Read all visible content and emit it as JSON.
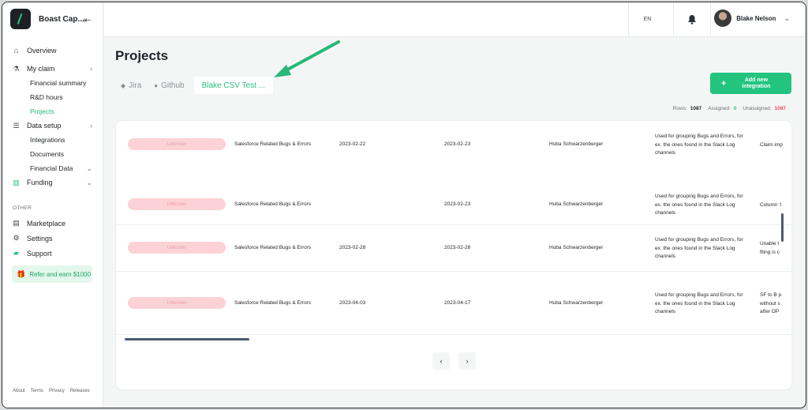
{
  "app": {
    "name": "Boast Cap..."
  },
  "sidebar": {
    "items": [
      {
        "label": "Overview",
        "icon": "home-icon"
      },
      {
        "label": "My claim",
        "icon": "flask-icon"
      },
      {
        "label": "Financial summary"
      },
      {
        "label": "R&D hours"
      },
      {
        "label": "Projects"
      },
      {
        "label": "Data setup",
        "icon": "list-icon"
      },
      {
        "label": "Integrations"
      },
      {
        "label": "Documents"
      },
      {
        "label": "Financial Data"
      },
      {
        "label": "Funding",
        "icon": "bank-icon"
      }
    ],
    "other_label": "OTHER",
    "other_items": [
      {
        "label": "Marketplace",
        "icon": "store-icon"
      },
      {
        "label": "Settings",
        "icon": "gear-icon"
      },
      {
        "label": "Support",
        "icon": "chat-icon"
      }
    ],
    "refer_label": "Refer and earn $1000",
    "footer": [
      "About",
      "Terms",
      "Privacy",
      "Releases"
    ]
  },
  "topbar": {
    "lang": "EN",
    "user_name": "Blake Nelson"
  },
  "page": {
    "title": "Projects",
    "tabs": [
      {
        "label": "Jira",
        "icon": "tag-icon"
      },
      {
        "label": "Github",
        "icon": "github-icon"
      },
      {
        "label": "Blake CSV Test ..."
      }
    ],
    "add_button": "Add new integration",
    "stats": {
      "rows_label": "Rows:",
      "rows": "1087",
      "assigned_label": "Assigned:",
      "assigned": "0",
      "unassigned_label": "Unassigned:",
      "unassigned": "1087"
    }
  },
  "table": {
    "rows": [
      {
        "status": "Unknown",
        "name": "Salesforce Related Bugs & Errors",
        "start": "2023-02-22",
        "end": "2023-02-23",
        "owner": "Huba Schwarzenberger",
        "description": "Used for grouping Bugs and Errors, for ex. the ones found in the Slack Log channels",
        "extra": "Claim imp"
      },
      {
        "status": "Unknown",
        "name": "Salesforce Related Bugs & Errors",
        "start": "",
        "end": "2023-02-23",
        "owner": "Huba Schwarzenberger",
        "description": "Used for grouping Bugs and Errors, for ex. the ones found in the Slack Log channels",
        "extra": "Column 'I"
      },
      {
        "status": "Unknown",
        "name": "Salesforce Related Bugs & Errors",
        "start": "2023-02-28",
        "end": "2023-02-28",
        "owner": "Huba Schwarzenberger",
        "description": "Used for grouping Bugs and Errors, for ex. the ones found in the Slack Log channels",
        "extra": "Unable t filing is c"
      },
      {
        "status": "Unknown",
        "name": "Salesforce Related Bugs & Errors",
        "start": "2023-04-03",
        "end": "2023-04-17",
        "owner": "Huba Schwarzenberger",
        "description": "Used for grouping Bugs and Errors, for ex. the ones found in the Slack Log channels",
        "extra": "SF to B p without s after OP"
      }
    ]
  },
  "colors": {
    "accent": "#22c47e",
    "danger": "#ea4d5b",
    "pill_bg": "#fcd2d6"
  }
}
